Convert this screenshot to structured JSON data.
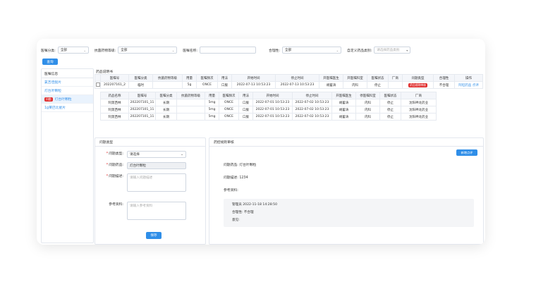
{
  "filters": {
    "order_category": {
      "label": "医嘱分类:",
      "value": "全部"
    },
    "antibacterial_level": {
      "label": "抗菌药物等级:",
      "value": "全部"
    },
    "order_name": {
      "label": "医嘱名称:",
      "value": ""
    },
    "rationality": {
      "label": "合理性:",
      "value": "全部"
    },
    "custom_drug_category": {
      "label": "自定义药品类别:",
      "placeholder": "请选择药品类别"
    }
  },
  "query_button": "查询",
  "left_panel": {
    "header": "医嘱信息",
    "items": [
      {
        "label": "氯吉佳醚片",
        "badge": ""
      },
      {
        "label": "灯台叶颗粒",
        "badge": ""
      },
      {
        "label": "灯台叶颗粒",
        "badge": "问题"
      },
      {
        "label": "1g莱巴比星片",
        "badge": ""
      }
    ]
  },
  "order_section_title": "药品说明书",
  "order_table": {
    "headers": [
      "",
      "医嘱号",
      "医嘱分类",
      "抗菌药物等级",
      "用量",
      "医嘱频次",
      "用法",
      "开始时间",
      "停止时间",
      "开医嘱医生",
      "开医嘱科室",
      "医嘱状态",
      "厂商",
      "问题类型",
      "合理性",
      "操作"
    ],
    "row": {
      "order_no": "202207161_2",
      "category": "临时",
      "level": "",
      "dose": "5g",
      "freq": "ONCE",
      "usage": "口服",
      "start": "2022-07-13 10:53:23",
      "stop": "2022-07-13 10:53:23",
      "doctor": "胡蓄涛",
      "dept": "内科",
      "status": "停止",
      "vendor": "",
      "issue_type": "药品规则审核",
      "rationality": "不合理",
      "action1": "阿坦药品",
      "action2": "点评"
    }
  },
  "detail_table": {
    "headers": [
      "药品名称",
      "医嘱号",
      "医嘱分类",
      "抗菌药物等级",
      "用量",
      "医嘱频次",
      "用法",
      "开始时间",
      "停止时间",
      "开医嘱医生",
      "停医嘱科室",
      "医嘱状态",
      "厂商"
    ],
    "rows": [
      {
        "name": "阿莫西林",
        "no": "202207101_11",
        "cat": "长期",
        "level": "",
        "dose": "5mg",
        "freq": "ONCE",
        "usage": "口服",
        "start": "2022-07-01 10:53:23",
        "stop": "2022-07-02 10:53:23",
        "doctor": "胡蓄涛",
        "dept": "内科",
        "status": "停止",
        "vendor": "沈阳神龙药业"
      },
      {
        "name": "阿莫西林",
        "no": "202207101_11",
        "cat": "长期",
        "level": "",
        "dose": "5mg",
        "freq": "ONCE",
        "usage": "口服",
        "start": "2022-07-01 10:53:23",
        "stop": "2022-07-02 10:53:23",
        "doctor": "胡蓄涛",
        "dept": "内科",
        "status": "停止",
        "vendor": "沈阳神龙药业"
      },
      {
        "name": "阿莫西林",
        "no": "202207101_11",
        "cat": "长期",
        "level": "",
        "dose": "5mg",
        "freq": "ONCE",
        "usage": "口服",
        "start": "2022-07-01 10:53:23",
        "stop": "2022-07-02 10:53:23",
        "doctor": "胡蓄涛",
        "dept": "内科",
        "status": "停止",
        "vendor": "沈阳神龙药业"
      }
    ]
  },
  "issue_form": {
    "title": "问题类型",
    "type_label": "问题类型:",
    "type_value": "请选择",
    "drug_label": "问题药品:",
    "drug_value": "灯台叶颗粒",
    "desc_label": "问题描述:",
    "desc_placeholder": "请输入问题描述",
    "ref_label": "参考资料:",
    "ref_placeholder": "请输入参考资料",
    "save": "保存"
  },
  "review_panel": {
    "title": "药控规则审核",
    "new_button": "新增点评",
    "drug_line": "问题药品:  灯台叶颗粒",
    "desc_line": "问题描述:  1234",
    "ref_line": "参考资料:",
    "admin_line": "管理员  2022-11-18 14:28:50",
    "rational_line": "合理性:  不合理",
    "opinion_line": "意见:"
  }
}
